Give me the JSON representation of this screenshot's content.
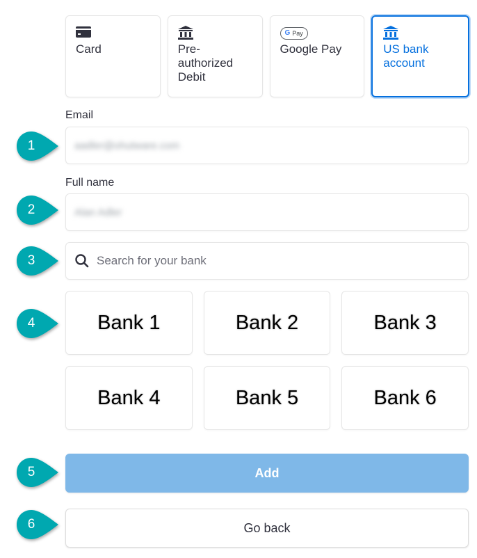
{
  "payment_methods": [
    {
      "label": "Card",
      "icon": "credit-card-icon",
      "selected": false
    },
    {
      "label": "Pre-\nauthorized\nDebit",
      "icon": "bank-icon",
      "selected": false
    },
    {
      "label": "Google Pay",
      "icon": "google-pay-icon",
      "badge": "Pay",
      "badge_g": "G",
      "selected": false
    },
    {
      "label": "US bank\naccount",
      "icon": "bank-icon",
      "selected": true
    }
  ],
  "form": {
    "email_label": "Email",
    "email_value": "aadler@ohutware.com",
    "full_name_label": "Full name",
    "full_name_value": "Alan Adler",
    "search_placeholder": "Search for your bank"
  },
  "banks": [
    "Bank 1",
    "Bank 2",
    "Bank 3",
    "Bank 4",
    "Bank 5",
    "Bank 6"
  ],
  "buttons": {
    "add_label": "Add",
    "go_back_label": "Go back"
  },
  "callouts": [
    "1",
    "2",
    "3",
    "4",
    "5",
    "6"
  ],
  "colors": {
    "accent": "#0570de",
    "add_button": "#7fb8e8",
    "callout": "#00a8b0"
  }
}
